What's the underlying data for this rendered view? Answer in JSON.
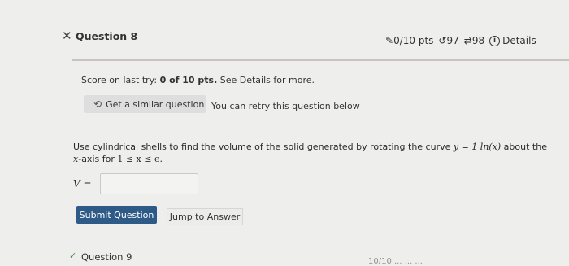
{
  "header": {
    "close_icon": "close-icon",
    "title": "Question 8",
    "points": "0/10 pts",
    "retry_count": "97",
    "attempt_count": "98",
    "details_label": "Details"
  },
  "score": {
    "prefix": "Score on last try: ",
    "value": "0 of 10 pts.",
    "suffix": " See Details for more."
  },
  "similar": {
    "button_label": "Get a similar question",
    "retry_text": "You can retry this question below"
  },
  "problem": {
    "line1_text": "Use cylindrical shells to find the volume of the solid generated by rotating the curve ",
    "equation": "y = 1 ln(x)",
    "line1_tail": " about the",
    "line2_axis": "x",
    "line2_text": "-axis for ",
    "interval": "1 ≤ x ≤ e."
  },
  "answer": {
    "label": "V =",
    "value": ""
  },
  "actions": {
    "submit_label": "Submit Question",
    "jump_label": "Jump to Answer"
  },
  "next_question": {
    "title": "Question 9",
    "partial_meta": "10/10 ... ... ..."
  }
}
